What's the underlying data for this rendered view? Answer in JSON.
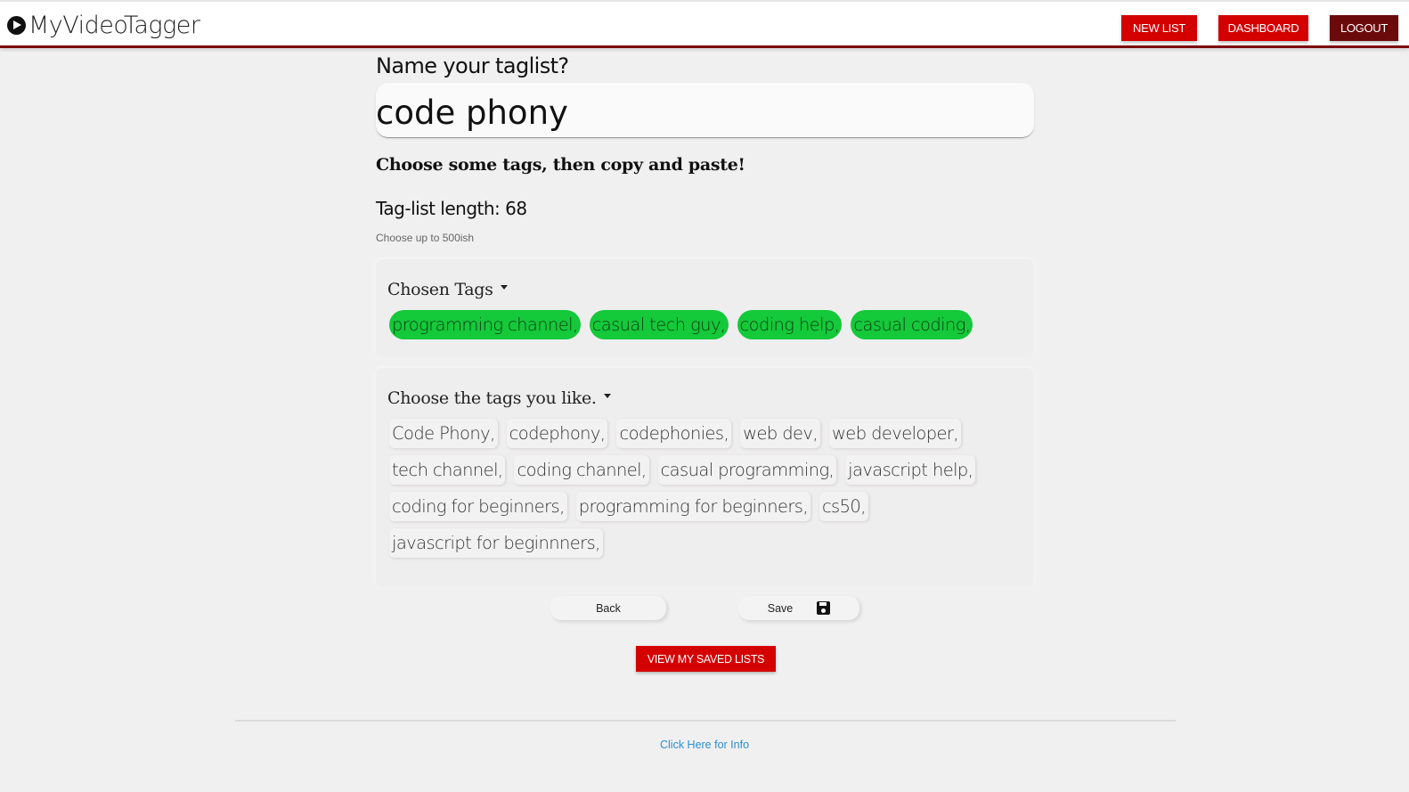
{
  "app": {
    "brand": "MyVideoTagger",
    "brand_icon": "play-circle-icon"
  },
  "nav": {
    "new_list": "NEW LIST",
    "dashboard": "DASHBOARD",
    "logout": "LOGOUT"
  },
  "colors": {
    "primary_red": "#d40000",
    "dark_red": "#6b0a0a",
    "chosen_green": "#14c93a",
    "link_blue": "#2b8fd6"
  },
  "form": {
    "name_label": "Name your taglist?",
    "name_value": "code phony",
    "instructions": "Choose some tags, then copy and paste!",
    "length_label": "Tag-list length: 68",
    "hint": "Choose up to 500ish"
  },
  "chosen": {
    "title": "Chosen Tags",
    "tags": [
      "programming channel,",
      "casual tech guy,",
      "coding help,",
      "casual coding,"
    ]
  },
  "choose": {
    "title": "Choose the tags you like.",
    "tags": [
      "Code Phony,",
      "codephony,",
      "codephonies,",
      "web dev,",
      "web developer,",
      "tech channel,",
      "coding channel,",
      "casual programming,",
      "javascript help,",
      "coding for beginners,",
      "programming for beginners,",
      "cs50,",
      "javascript for beginnners,"
    ]
  },
  "actions": {
    "back": "Back",
    "save": "Save",
    "save_icon": "floppy-disk-icon",
    "view_saved": "VIEW MY SAVED LISTS"
  },
  "footer": {
    "info_link": "Click Here for Info"
  }
}
